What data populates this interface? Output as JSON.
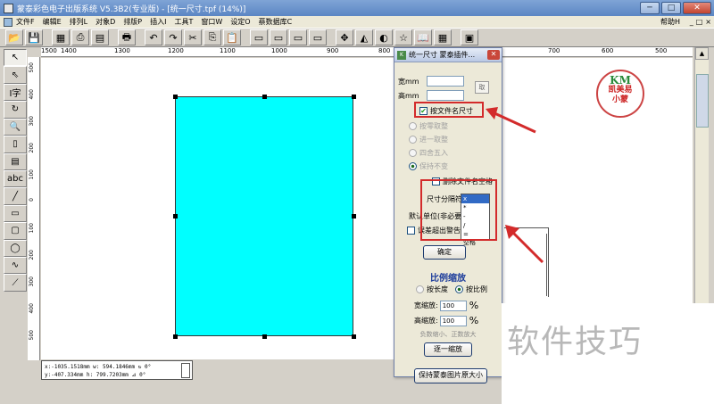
{
  "window": {
    "title": "蒙泰彩色电子出版系统 V5.3B2(专业版) - [统一尺寸.tpf (14%)]",
    "controls": [
      "─",
      "□",
      "✕"
    ]
  },
  "menubar": {
    "items": [
      "文件F",
      "编辑E",
      "排列L",
      "对象D",
      "排版P",
      "插入I",
      "工具T",
      "窗口W",
      "设定O",
      "蔡数据库C"
    ],
    "help": "帮助H",
    "mdi_controls": [
      "_",
      "□",
      "×"
    ]
  },
  "ruler": {
    "top_labels": [
      "1500",
      "1400",
      "1300",
      "1200",
      "1100",
      "1000",
      "900",
      "800",
      "700",
      "600",
      "500"
    ],
    "left_labels": [
      "500",
      "400",
      "300",
      "200",
      "100",
      "0",
      "100",
      "200",
      "300",
      "400",
      "500"
    ]
  },
  "status": {
    "line1": "x:-1035.1518mm w: 594.1846mm  ↻ 0°",
    "line2": "y:-407.334mm   h: 799.7203mm  ⊿ 0°"
  },
  "logo": {
    "mark": "KM",
    "line1": "凯美易",
    "line2": "小蒙"
  },
  "dialog": {
    "title": "统一尺寸 蒙泰插件...",
    "width_label": "宽mm",
    "height_label": "高mm",
    "fetch_button": "取",
    "by_filename_size": "按文件名尺寸",
    "radio_options": [
      "按零取整",
      "进一取整",
      "四舍五入",
      "保持不变"
    ],
    "remove_space": "删除文件名空格",
    "separator_label": "尺寸分隔符",
    "separator_value": "x",
    "default_unit": "默认单位(非必要)",
    "error_label": "误差超出警告mm",
    "confirm_button": "确定",
    "separator_options": [
      "x",
      "*",
      "-",
      "/",
      "=",
      "空格"
    ],
    "scale_title": "比例缩放",
    "by_length": "按长度",
    "by_ratio": "按比例",
    "width_scale_label": "宽缩放:",
    "width_scale_value": "100",
    "height_scale_label": "高缩放:",
    "height_scale_value": "100",
    "percent": "%",
    "hint": "负数缩小、正数放大",
    "scale_button": "逐一缩放",
    "keep_size_button": "保持蒙泰图片原大小"
  },
  "watermark": {
    "text": "软件技巧"
  },
  "colors": {
    "page_fill": "#00ffff",
    "highlight": "#d32b2b",
    "scale_title": "#1a3a9a"
  }
}
